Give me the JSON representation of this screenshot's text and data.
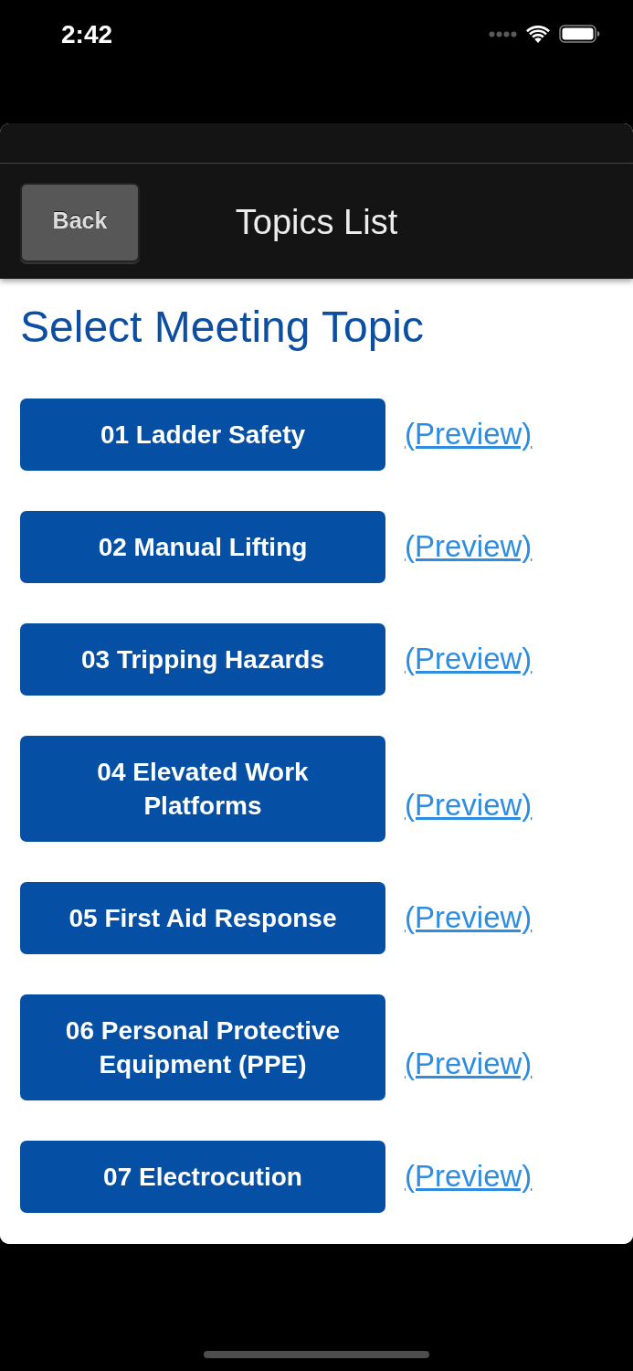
{
  "status_bar": {
    "time": "2:42"
  },
  "header": {
    "back_button": "Back",
    "title": "Topics List"
  },
  "heading": "Select Meeting Topic",
  "topics": [
    {
      "label": "01 Ladder Safety",
      "link": "(Preview)"
    },
    {
      "label": "02 Manual Lifting",
      "link": "(Preview)"
    },
    {
      "label": "03 Tripping Hazards",
      "link": "(Preview)"
    },
    {
      "label": "04 Elevated Work Platforms",
      "link": "(Preview)"
    },
    {
      "label": "05 First Aid Response",
      "link": "(Preview)"
    },
    {
      "label": "06 Personal Protective Equipment (PPE)",
      "link": "(Preview)"
    },
    {
      "label": "07 Electrocution",
      "link": "(Preview)"
    }
  ]
}
